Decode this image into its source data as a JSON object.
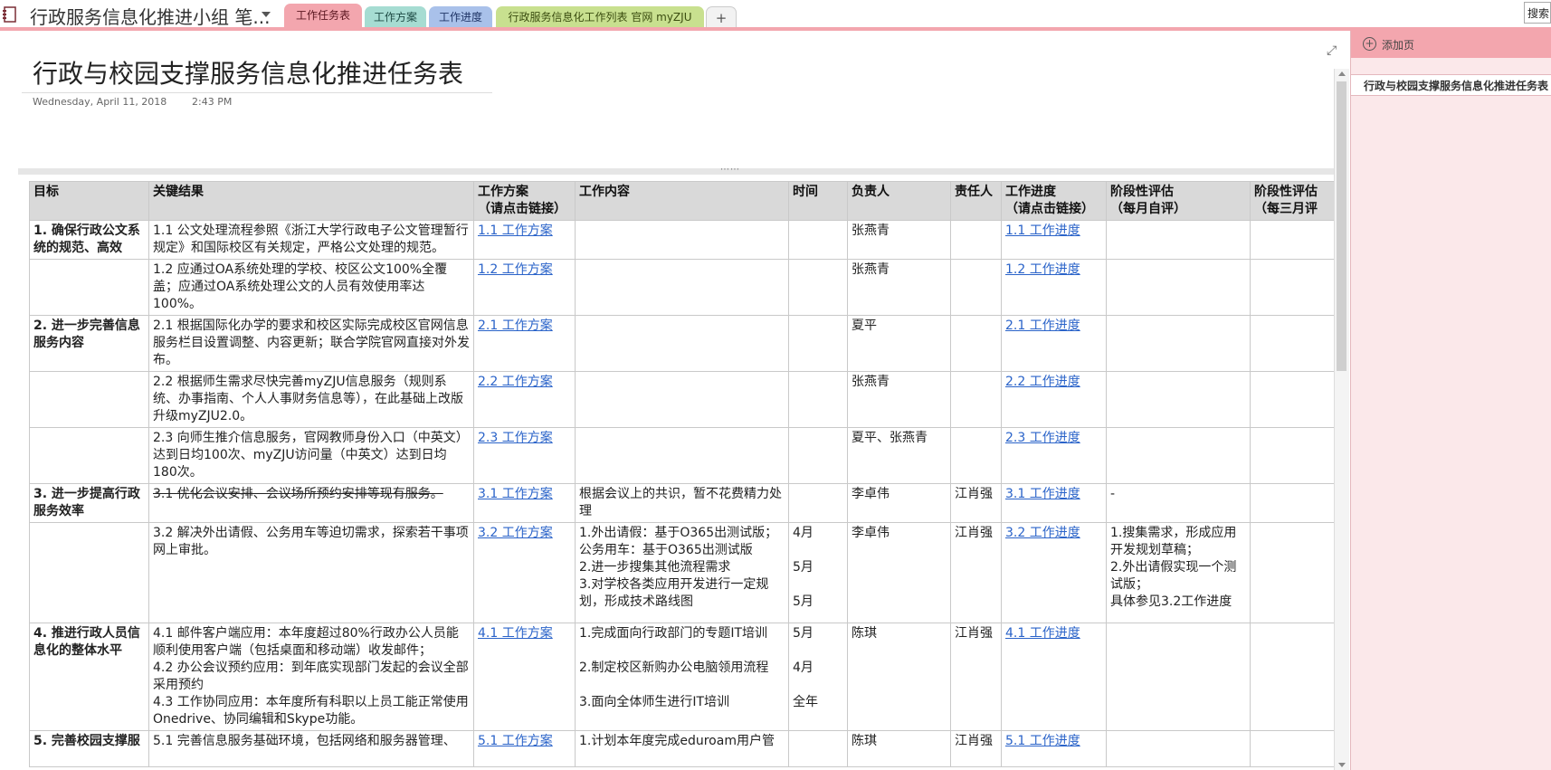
{
  "notebook": {
    "title": "行政服务信息化推进小组 笔...",
    "icon": "notebook-icon"
  },
  "tabs": [
    {
      "label": "工作任务表",
      "color": "#f3a6ae",
      "active": true
    },
    {
      "label": "工作方案",
      "color": "#a6dcd2"
    },
    {
      "label": "工作进度",
      "color": "#a9c1ea"
    },
    {
      "label": "行政服务信息化工作列表 官网 myZJU",
      "color": "#c8e08f"
    },
    {
      "label": "+"
    }
  ],
  "search": {
    "label": "搜索"
  },
  "page": {
    "title": "行政与校园支撑服务信息化推进任务表",
    "date": "Wednesday, April 11, 2018",
    "time": "2:43 PM"
  },
  "table": {
    "headers": [
      "目标",
      "关键结果",
      "工作方案\n（请点击链接）",
      "工作内容",
      "时间",
      "负责人",
      "责任人",
      "工作进度\n（请点击链接）",
      "阶段性评估\n（每月自评）",
      "阶段性评估\n（每三月评"
    ],
    "rows": [
      {
        "goal": "1. 确保行政公文系统的规范、高效",
        "kr": "1.1 公文处理流程参照《浙江大学行政电子公文管理暂行规定》和国际校区有关规定，严格公文处理的规范。",
        "plan": "1.1 工作方案",
        "content": "",
        "time": "",
        "owner": "张燕青",
        "resp": "",
        "progress": "1.1 工作进度",
        "eval": ""
      },
      {
        "goal": "",
        "kr": "1.2 应通过OA系统处理的学校、校区公文100%全覆盖；应通过OA系统处理公文的人员有效使用率达100%。",
        "plan": "1.2 工作方案",
        "content": "",
        "time": "",
        "owner": "张燕青",
        "resp": "",
        "progress": "1.2 工作进度",
        "eval": ""
      },
      {
        "goal": "2. 进一步完善信息服务内容",
        "kr": "2.1 根据国际化办学的要求和校区实际完成校区官网信息服务栏目设置调整、内容更新；联合学院官网直接对外发布。",
        "plan": "2.1 工作方案",
        "content": "",
        "time": "",
        "owner": "夏平",
        "resp": "",
        "progress": "2.1 工作进度",
        "eval": ""
      },
      {
        "goal": "",
        "kr": "2.2 根据师生需求尽快完善myZJU信息服务（规则系统、办事指南、个人人事财务信息等），在此基础上改版升级myZJU2.0。",
        "plan": "2.2 工作方案",
        "content": "",
        "time": "",
        "owner": "张燕青",
        "resp": "",
        "progress": "2.2 工作进度",
        "eval": ""
      },
      {
        "goal": "",
        "kr": "2.3 向师生推介信息服务，官网教师身份入口（中英文）达到日均100次、myZJU访问量（中英文）达到日均180次。",
        "plan": "2.3 工作方案",
        "content": "",
        "time": "",
        "owner": "夏平、张燕青",
        "resp": "",
        "progress": "2.3 工作进度",
        "eval": ""
      },
      {
        "goal": "3. 进一步提高行政服务效率",
        "kr": "3.1 优化会议安排、会议场所预约安排等现有服务。",
        "krStrike": true,
        "plan": "3.1 工作方案",
        "content": "根据会议上的共识，暂不花费精力处理",
        "time": "",
        "owner": "李卓伟",
        "resp": "江肖强",
        "progress": "3.1 工作进度",
        "eval": "-"
      },
      {
        "goal": "",
        "kr": "3.2 解决外出请假、公务用车等迫切需求，探索若干事项网上审批。",
        "plan": "3.2 工作方案",
        "content": "1.外出请假：基于O365出测试版；\n公务用车：基于O365出测试版\n2.进一步搜集其他流程需求\n3.对学校各类应用开发进行一定规划，形成技术路线图",
        "time": "4月\n\n5月\n\n5月",
        "owner": "李卓伟",
        "resp": "江肖强",
        "progress": "3.2 工作进度",
        "eval": "1.搜集需求，形成应用开发规划草稿；\n2.外出请假实现一个测试版；\n具体参见3.2工作进度"
      },
      {
        "goal": "4. 推进行政人员信息化的整体水平",
        "kr": "4.1 邮件客户端应用：本年度超过80%行政办公人员能顺利使用客户端（包括桌面和移动端）收发邮件；\n4.2 办公会议预约应用：到年底实现部门发起的会议全部采用预约\n4.3 工作协同应用：本年度所有科职以上员工能正常使用Onedrive、协同编辑和Skype功能。",
        "plan": "4.1 工作方案",
        "content": "1.完成面向行政部门的专题IT培训\n\n2.制定校区新购办公电脑领用流程\n\n3.面向全体师生进行IT培训",
        "time": "5月\n\n4月\n\n全年",
        "owner": "陈琪",
        "resp": "江肖强",
        "progress": "4.1 工作进度",
        "eval": ""
      },
      {
        "goal": "5. 完善校园支撑服",
        "kr": "5.1 完善信息服务基础环境，包括网络和服务器管理、",
        "plan": "5.1 工作方案",
        "content": "1.计划本年度完成eduroam用户管",
        "time": "",
        "owner": "陈琪",
        "resp": "江肖强",
        "progress": "5.1 工作进度",
        "eval": ""
      }
    ]
  },
  "pagePane": {
    "addPage": "添加页",
    "pages": [
      "行政与校园支撑服务信息化推进任务表"
    ]
  }
}
